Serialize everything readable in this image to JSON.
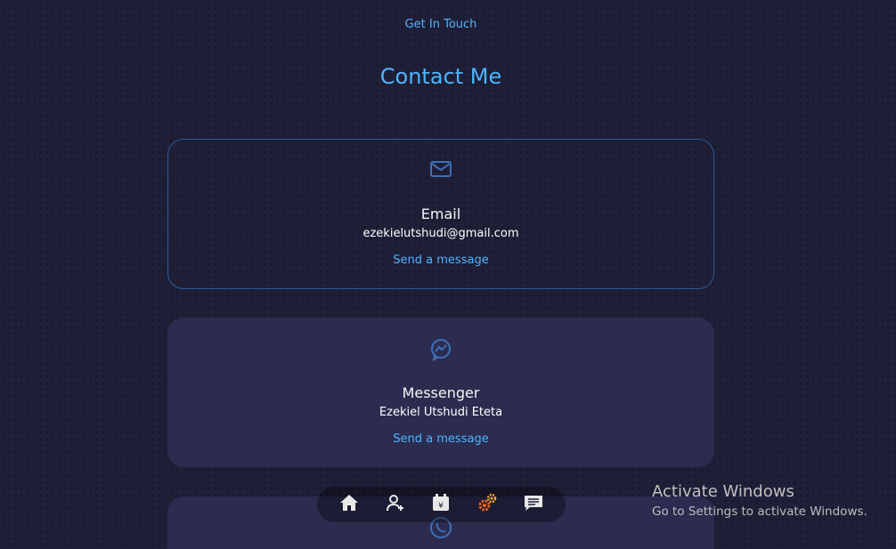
{
  "header": {
    "subtitle": "Get In Touch",
    "title": "Contact Me"
  },
  "contacts": [
    {
      "icon": "mail-icon",
      "name": "Email",
      "value": "ezekielutshudi@gmail.com",
      "link": "Send a message"
    },
    {
      "icon": "messenger-icon",
      "name": "Messenger",
      "value": "Ezekiel Utshudi Eteta",
      "link": "Send a message"
    },
    {
      "icon": "whatsapp-icon",
      "name": "",
      "value": "",
      "link": ""
    }
  ],
  "nav": {
    "items": [
      {
        "icon": "home-icon"
      },
      {
        "icon": "user-icon"
      },
      {
        "icon": "calendar-icon"
      },
      {
        "icon": "gears-icon"
      },
      {
        "icon": "message-icon"
      }
    ]
  },
  "watermark": {
    "title": "Activate Windows",
    "subtitle": "Go to Settings to activate Windows."
  },
  "colors": {
    "background": "#1f1f38",
    "accent": "#4db5ff",
    "card": "#2c2c50",
    "card_border": "#2c5a98"
  }
}
